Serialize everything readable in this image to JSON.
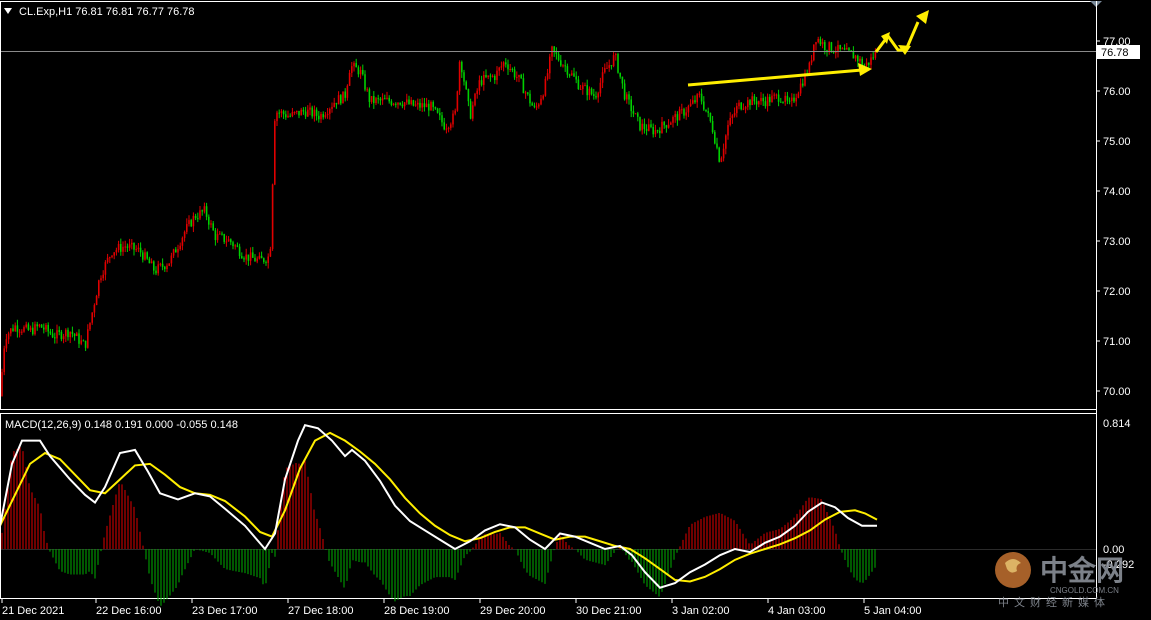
{
  "symbol_header": "CL.Exp,H1  76.81 76.81 76.77 76.78",
  "macd_header": "MACD(12,26,9) 0.148 0.191 0.000 -0.055 0.148",
  "current_price": "76.78",
  "price_axis_labels": [
    "77.00",
    "76.00",
    "75.00",
    "74.00",
    "73.00",
    "72.00",
    "71.00",
    "70.00"
  ],
  "macd_axis_labels": [
    "0.814",
    "0.00",
    "-0.292"
  ],
  "time_labels": [
    "21 Dec 2021",
    "22 Dec 16:00",
    "23 Dec 17:00",
    "27 Dec 18:00",
    "28 Dec 19:00",
    "29 Dec 20:00",
    "30 Dec 21:00",
    "3 Jan 02:00",
    "4 Jan 03:00",
    "5 Jan 04:00"
  ],
  "watermark": {
    "name": "中金网",
    "domain": "CNGOLD.COM.CN",
    "slogan": "中文财经新媒体"
  },
  "colors": {
    "background": "#000000",
    "bull": "#00d000",
    "bear": "#e00000",
    "macd_main": "#ffffff",
    "macd_signal": "#ffee00",
    "annotation": "#ffee00"
  },
  "chart_data": [
    {
      "type": "candlestick",
      "title": "CL.Exp,H1",
      "ylim": [
        69.7,
        77.8
      ],
      "y_ticks": [
        70,
        71,
        72,
        73,
        74,
        75,
        76,
        77
      ],
      "last_close": 76.78,
      "close_path": [
        [
          0,
          69.9
        ],
        [
          5,
          71.1
        ],
        [
          15,
          71.3
        ],
        [
          30,
          71.2
        ],
        [
          40,
          71.3
        ],
        [
          55,
          71.1
        ],
        [
          70,
          71.2
        ],
        [
          85,
          70.9
        ],
        [
          100,
          72.3
        ],
        [
          112,
          72.8
        ],
        [
          125,
          72.9
        ],
        [
          140,
          72.8
        ],
        [
          155,
          72.4
        ],
        [
          170,
          72.6
        ],
        [
          185,
          73.2
        ],
        [
          195,
          73.5
        ],
        [
          205,
          73.6
        ],
        [
          215,
          73.1
        ],
        [
          230,
          73.0
        ],
        [
          245,
          72.7
        ],
        [
          260,
          72.6
        ],
        [
          270,
          72.7
        ],
        [
          275,
          75.6
        ],
        [
          290,
          75.5
        ],
        [
          305,
          75.6
        ],
        [
          320,
          75.5
        ],
        [
          335,
          75.8
        ],
        [
          345,
          75.9
        ],
        [
          350,
          76.5
        ],
        [
          360,
          76.4
        ],
        [
          370,
          75.8
        ],
        [
          385,
          75.8
        ],
        [
          400,
          75.8
        ],
        [
          415,
          75.7
        ],
        [
          430,
          75.7
        ],
        [
          445,
          75.3
        ],
        [
          455,
          75.5
        ],
        [
          460,
          76.7
        ],
        [
          470,
          75.5
        ],
        [
          480,
          76.2
        ],
        [
          495,
          76.3
        ],
        [
          505,
          76.6
        ],
        [
          520,
          76.2
        ],
        [
          535,
          75.6
        ],
        [
          545,
          76.1
        ],
        [
          552,
          76.8
        ],
        [
          565,
          76.5
        ],
        [
          580,
          76.1
        ],
        [
          595,
          75.9
        ],
        [
          605,
          76.4
        ],
        [
          615,
          76.7
        ],
        [
          625,
          75.9
        ],
        [
          640,
          75.3
        ],
        [
          655,
          75.2
        ],
        [
          670,
          75.4
        ],
        [
          685,
          75.6
        ],
        [
          700,
          75.9
        ],
        [
          712,
          75.3
        ],
        [
          720,
          74.6
        ],
        [
          728,
          75.3
        ],
        [
          738,
          75.7
        ],
        [
          750,
          75.8
        ],
        [
          765,
          75.8
        ],
        [
          780,
          75.9
        ],
        [
          790,
          75.7
        ],
        [
          800,
          76.1
        ],
        [
          810,
          76.5
        ],
        [
          815,
          77.1
        ],
        [
          825,
          76.9
        ],
        [
          840,
          76.8
        ],
        [
          855,
          76.7
        ],
        [
          865,
          76.5
        ],
        [
          870,
          76.6
        ],
        [
          876,
          76.78
        ]
      ]
    },
    {
      "type": "macd",
      "title": "MACD(12,26,9)",
      "ylim": [
        -0.292,
        0.814
      ],
      "values": {
        "main": 0.148,
        "signal": 0.191,
        "histogram": -0.055
      },
      "main_path": [
        [
          0,
          0.15
        ],
        [
          12,
          0.55
        ],
        [
          22,
          0.7
        ],
        [
          40,
          0.7
        ],
        [
          50,
          0.6
        ],
        [
          70,
          0.45
        ],
        [
          85,
          0.35
        ],
        [
          95,
          0.3
        ],
        [
          105,
          0.4
        ],
        [
          120,
          0.62
        ],
        [
          135,
          0.64
        ],
        [
          148,
          0.5
        ],
        [
          160,
          0.36
        ],
        [
          178,
          0.32
        ],
        [
          195,
          0.36
        ],
        [
          210,
          0.34
        ],
        [
          225,
          0.26
        ],
        [
          245,
          0.15
        ],
        [
          265,
          0.0
        ],
        [
          275,
          0.1
        ],
        [
          285,
          0.45
        ],
        [
          298,
          0.7
        ],
        [
          305,
          0.8
        ],
        [
          318,
          0.78
        ],
        [
          332,
          0.7
        ],
        [
          345,
          0.6
        ],
        [
          352,
          0.64
        ],
        [
          365,
          0.57
        ],
        [
          380,
          0.44
        ],
        [
          395,
          0.28
        ],
        [
          410,
          0.18
        ],
        [
          425,
          0.12
        ],
        [
          440,
          0.06
        ],
        [
          455,
          0.0
        ],
        [
          470,
          0.05
        ],
        [
          485,
          0.12
        ],
        [
          500,
          0.16
        ],
        [
          515,
          0.14
        ],
        [
          530,
          0.06
        ],
        [
          545,
          0.0
        ],
        [
          560,
          0.1
        ],
        [
          575,
          0.08
        ],
        [
          590,
          0.04
        ],
        [
          605,
          0.0
        ],
        [
          620,
          0.02
        ],
        [
          632,
          -0.04
        ],
        [
          645,
          -0.15
        ],
        [
          660,
          -0.25
        ],
        [
          675,
          -0.22
        ],
        [
          690,
          -0.15
        ],
        [
          705,
          -0.1
        ],
        [
          720,
          -0.04
        ],
        [
          735,
          0.0
        ],
        [
          750,
          -0.02
        ],
        [
          765,
          0.04
        ],
        [
          780,
          0.08
        ],
        [
          795,
          0.15
        ],
        [
          808,
          0.24
        ],
        [
          822,
          0.3
        ],
        [
          835,
          0.27
        ],
        [
          848,
          0.2
        ],
        [
          862,
          0.15
        ],
        [
          877,
          0.15
        ]
      ],
      "signal_path": [
        [
          0,
          0.15
        ],
        [
          15,
          0.35
        ],
        [
          30,
          0.55
        ],
        [
          45,
          0.62
        ],
        [
          60,
          0.58
        ],
        [
          75,
          0.48
        ],
        [
          90,
          0.38
        ],
        [
          105,
          0.36
        ],
        [
          120,
          0.45
        ],
        [
          135,
          0.54
        ],
        [
          150,
          0.55
        ],
        [
          165,
          0.48
        ],
        [
          180,
          0.4
        ],
        [
          195,
          0.36
        ],
        [
          210,
          0.35
        ],
        [
          225,
          0.31
        ],
        [
          245,
          0.21
        ],
        [
          260,
          0.11
        ],
        [
          272,
          0.08
        ],
        [
          285,
          0.25
        ],
        [
          300,
          0.52
        ],
        [
          315,
          0.7
        ],
        [
          330,
          0.75
        ],
        [
          345,
          0.7
        ],
        [
          360,
          0.63
        ],
        [
          375,
          0.55
        ],
        [
          390,
          0.45
        ],
        [
          405,
          0.33
        ],
        [
          420,
          0.23
        ],
        [
          435,
          0.15
        ],
        [
          450,
          0.09
        ],
        [
          465,
          0.05
        ],
        [
          480,
          0.07
        ],
        [
          495,
          0.11
        ],
        [
          510,
          0.14
        ],
        [
          525,
          0.14
        ],
        [
          540,
          0.1
        ],
        [
          555,
          0.06
        ],
        [
          570,
          0.08
        ],
        [
          585,
          0.08
        ],
        [
          600,
          0.05
        ],
        [
          615,
          0.02
        ],
        [
          630,
          0.0
        ],
        [
          645,
          -0.06
        ],
        [
          660,
          -0.13
        ],
        [
          675,
          -0.2
        ],
        [
          690,
          -0.21
        ],
        [
          705,
          -0.18
        ],
        [
          720,
          -0.13
        ],
        [
          735,
          -0.07
        ],
        [
          750,
          -0.03
        ],
        [
          765,
          0.0
        ],
        [
          780,
          0.03
        ],
        [
          795,
          0.07
        ],
        [
          810,
          0.12
        ],
        [
          825,
          0.19
        ],
        [
          840,
          0.24
        ],
        [
          855,
          0.25
        ],
        [
          865,
          0.23
        ],
        [
          877,
          0.19
        ]
      ]
    }
  ]
}
